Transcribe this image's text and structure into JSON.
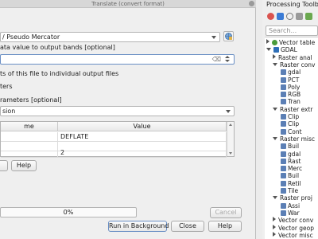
{
  "window": {
    "title": "Translate (convert format)"
  },
  "params": {
    "crs_value": "/ Pseudo Mercator",
    "nodata_label": "ata value to output bands [optional]",
    "nodata_value": "",
    "copy_subdatasets_label": "ts of this file to individual output files",
    "raster_options_label": "ters",
    "additional_params_label": "rameters [optional]",
    "profile_value": "sion"
  },
  "options_table": {
    "headers": [
      "me",
      "Value"
    ],
    "rows": [
      {
        "name": "",
        "value": "DEFLATE"
      },
      {
        "name": "",
        "value": ""
      },
      {
        "name": "",
        "value": "2"
      }
    ]
  },
  "table_buttons": {
    "help": "Help"
  },
  "progress": {
    "value": 0,
    "text": "0%"
  },
  "buttons": {
    "cancel": "Cancel",
    "run_background": "Run in Background",
    "close": "Close",
    "help": "Help"
  },
  "toolbox": {
    "title": "Processing Toolbo",
    "search_placeholder": "Search...",
    "items": [
      {
        "label": "Vector table",
        "indent": 0,
        "arrow": "right",
        "icon": "q-icon"
      },
      {
        "label": "GDAL",
        "indent": 0,
        "arrow": "down",
        "icon": "gdal-icon"
      },
      {
        "label": "Raster anal",
        "indent": 1,
        "arrow": "right",
        "icon": ""
      },
      {
        "label": "Raster conv",
        "indent": 1,
        "arrow": "down",
        "icon": ""
      },
      {
        "label": "gdal",
        "indent": 2,
        "arrow": "",
        "icon": "tool-icon"
      },
      {
        "label": "PCT",
        "indent": 2,
        "arrow": "",
        "icon": "tool-icon"
      },
      {
        "label": "Poly",
        "indent": 2,
        "arrow": "",
        "icon": "tool-icon"
      },
      {
        "label": "RGB",
        "indent": 2,
        "arrow": "",
        "icon": "tool-icon"
      },
      {
        "label": "Tran",
        "indent": 2,
        "arrow": "",
        "icon": "tool-icon"
      },
      {
        "label": "Raster extr",
        "indent": 1,
        "arrow": "down",
        "icon": ""
      },
      {
        "label": "Clip",
        "indent": 2,
        "arrow": "",
        "icon": "tool-icon"
      },
      {
        "label": "Clip",
        "indent": 2,
        "arrow": "",
        "icon": "tool-icon"
      },
      {
        "label": "Cont",
        "indent": 2,
        "arrow": "",
        "icon": "tool-icon"
      },
      {
        "label": "Raster misc",
        "indent": 1,
        "arrow": "down",
        "icon": ""
      },
      {
        "label": "Buil",
        "indent": 2,
        "arrow": "",
        "icon": "tool-icon"
      },
      {
        "label": "gdal",
        "indent": 2,
        "arrow": "",
        "icon": "tool-icon"
      },
      {
        "label": "Rast",
        "indent": 2,
        "arrow": "",
        "icon": "tool-icon"
      },
      {
        "label": "Merc",
        "indent": 2,
        "arrow": "",
        "icon": "tool-icon"
      },
      {
        "label": "Buil",
        "indent": 2,
        "arrow": "",
        "icon": "tool-icon"
      },
      {
        "label": "Retil",
        "indent": 2,
        "arrow": "",
        "icon": "tool-icon"
      },
      {
        "label": "Tile",
        "indent": 2,
        "arrow": "",
        "icon": "tool-icon"
      },
      {
        "label": "Raster proj",
        "indent": 1,
        "arrow": "down",
        "icon": ""
      },
      {
        "label": "Assi",
        "indent": 2,
        "arrow": "",
        "icon": "tool-icon"
      },
      {
        "label": "War",
        "indent": 2,
        "arrow": "",
        "icon": "tool-icon"
      },
      {
        "label": "Vector conv",
        "indent": 1,
        "arrow": "right",
        "icon": ""
      },
      {
        "label": "Vector geop",
        "indent": 1,
        "arrow": "right",
        "icon": ""
      },
      {
        "label": "Vector misc",
        "indent": 1,
        "arrow": "right",
        "icon": ""
      }
    ]
  },
  "colors": {
    "accent": "#6a8fc4",
    "gdal_green": "#4a9b3a",
    "tool_blue": "#5b7fb5"
  }
}
